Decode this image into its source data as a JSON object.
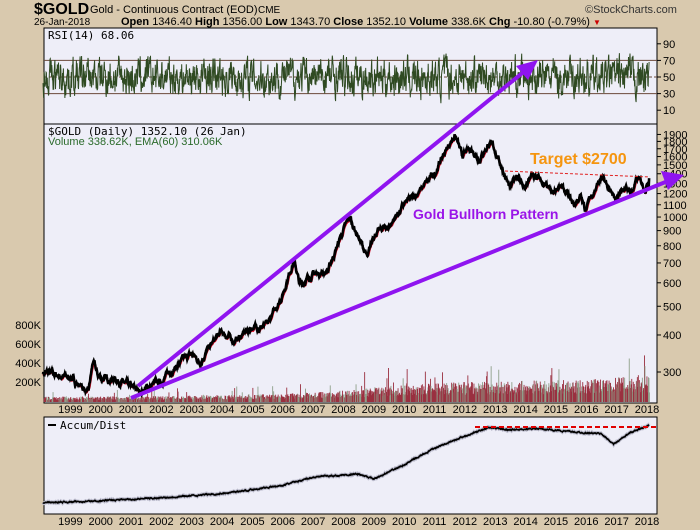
{
  "header": {
    "symbol": "$GOLD",
    "name": "Gold - Continuous Contract (EOD)",
    "exchange": "CME",
    "date": "26-Jan-2018",
    "watermark": "©StockCharts.com",
    "open_label": "Open",
    "open": "1346.40",
    "high_label": "High",
    "high": "1356.00",
    "low_label": "Low",
    "low": "1343.70",
    "close_label": "Close",
    "close": "1352.10",
    "volume_label": "Volume",
    "volume": "338.6K",
    "chg_label": "Chg",
    "chg": "-10.80 (-0.79%)",
    "chg_icon": "triangle-down-icon"
  },
  "colors": {
    "background": "#d9c9ae",
    "plot": "#eeeef8",
    "price": "#000000",
    "ma": "#e0102a",
    "rsi": "#2f4a22",
    "trend": "#8f14f0",
    "target_text": "#f5950f",
    "volume": "#9a3040",
    "volume_up": "#8fa08a"
  },
  "rsi_panel": {
    "legend": "RSI(14) 68.06",
    "ticks": [
      "90",
      "70",
      "50",
      "30",
      "10"
    ]
  },
  "price_panel": {
    "legend": "$GOLD (Daily) 1352.10 (26 Jan)",
    "volume_legend": "Volume 338.62K, EMA(60) 310.06K",
    "annotation_target": "Target $2700",
    "annotation_pattern": "Gold Bullhorn Pattern"
  },
  "ad_panel": {
    "legend": "Accum/Dist"
  },
  "chart_data": [
    {
      "type": "line",
      "title": "RSI(14)",
      "ylim": [
        0,
        100
      ],
      "reference_lines": [
        30,
        50,
        70
      ],
      "last_value": 68.06
    },
    {
      "type": "line",
      "title": "$GOLD (Daily)",
      "scale": "log",
      "ylim": [
        236,
        1960
      ],
      "x_ticks": [
        "1999",
        "2000",
        "2001",
        "2002",
        "2003",
        "2004",
        "2005",
        "2006",
        "2007",
        "2008",
        "2009",
        "2010",
        "2011",
        "2012",
        "2013",
        "2014",
        "2015",
        "2016",
        "2017",
        "2018"
      ],
      "y_ticks": [
        300,
        400,
        500,
        600,
        700,
        800,
        900,
        1000,
        1100,
        1200,
        1300,
        1400,
        1500,
        1600,
        1700,
        1800,
        1900
      ],
      "volume_ticks": [
        "200K",
        "400K",
        "600K",
        "800K"
      ],
      "series": [
        {
          "x": [
            1998.1,
            1998.7,
            1999.0,
            1999.6,
            1999.75,
            1999.9,
            2000.1,
            2000.5,
            2001.0,
            2001.3,
            2002.0,
            2002.5,
            2003.0,
            2003.25,
            2004.0,
            2004.4,
            2005.0,
            2005.5,
            2006.0,
            2006.37,
            2006.55,
            2007.0,
            2007.5,
            2008.0,
            2008.2,
            2008.8,
            2009.0,
            2009.5,
            2010.0,
            2010.5,
            2011.0,
            2011.67,
            2011.9,
            2012.2,
            2012.5,
            2012.8,
            2013.0,
            2013.3,
            2013.5,
            2013.7,
            2014.0,
            2014.2,
            2014.5,
            2014.9,
            2015.1,
            2015.6,
            2015.8,
            2015.95,
            2016.5,
            2016.9,
            2017.0,
            2017.2,
            2017.5,
            2017.7,
            2017.95,
            2018.07
          ],
          "y": [
            300,
            290,
            288,
            255,
            325,
            290,
            285,
            285,
            265,
            258,
            280,
            315,
            345,
            325,
            410,
            380,
            425,
            430,
            550,
            720,
            590,
            640,
            660,
            900,
            990,
            720,
            880,
            930,
            1100,
            1220,
            1400,
            1900,
            1600,
            1700,
            1580,
            1780,
            1670,
            1400,
            1230,
            1400,
            1240,
            1380,
            1320,
            1180,
            1290,
            1090,
            1180,
            1060,
            1360,
            1150,
            1160,
            1260,
            1220,
            1340,
            1260,
            1352
          ]
        }
      ],
      "volume": {
        "x": [
          1998,
          2002,
          2006,
          2008,
          2010,
          2012,
          2014,
          2016,
          2018
        ],
        "y": [
          40000,
          45000,
          60000,
          90000,
          130000,
          150000,
          160000,
          170000,
          200000
        ]
      }
    },
    {
      "type": "line",
      "title": "Accum/Dist",
      "series": [
        {
          "x": [
            1998.1,
            2000,
            2002,
            2004,
            2006,
            2007,
            2008.5,
            2009,
            2010,
            2011,
            2012,
            2012.8,
            2013.5,
            2014.5,
            2015.5,
            2016.5,
            2016.9,
            2017.5,
            2018.07
          ],
          "y": [
            5,
            7,
            10,
            14,
            22,
            30,
            33,
            28,
            42,
            58,
            70,
            78,
            76,
            77,
            74,
            72,
            62,
            74,
            80
          ]
        }
      ]
    }
  ]
}
